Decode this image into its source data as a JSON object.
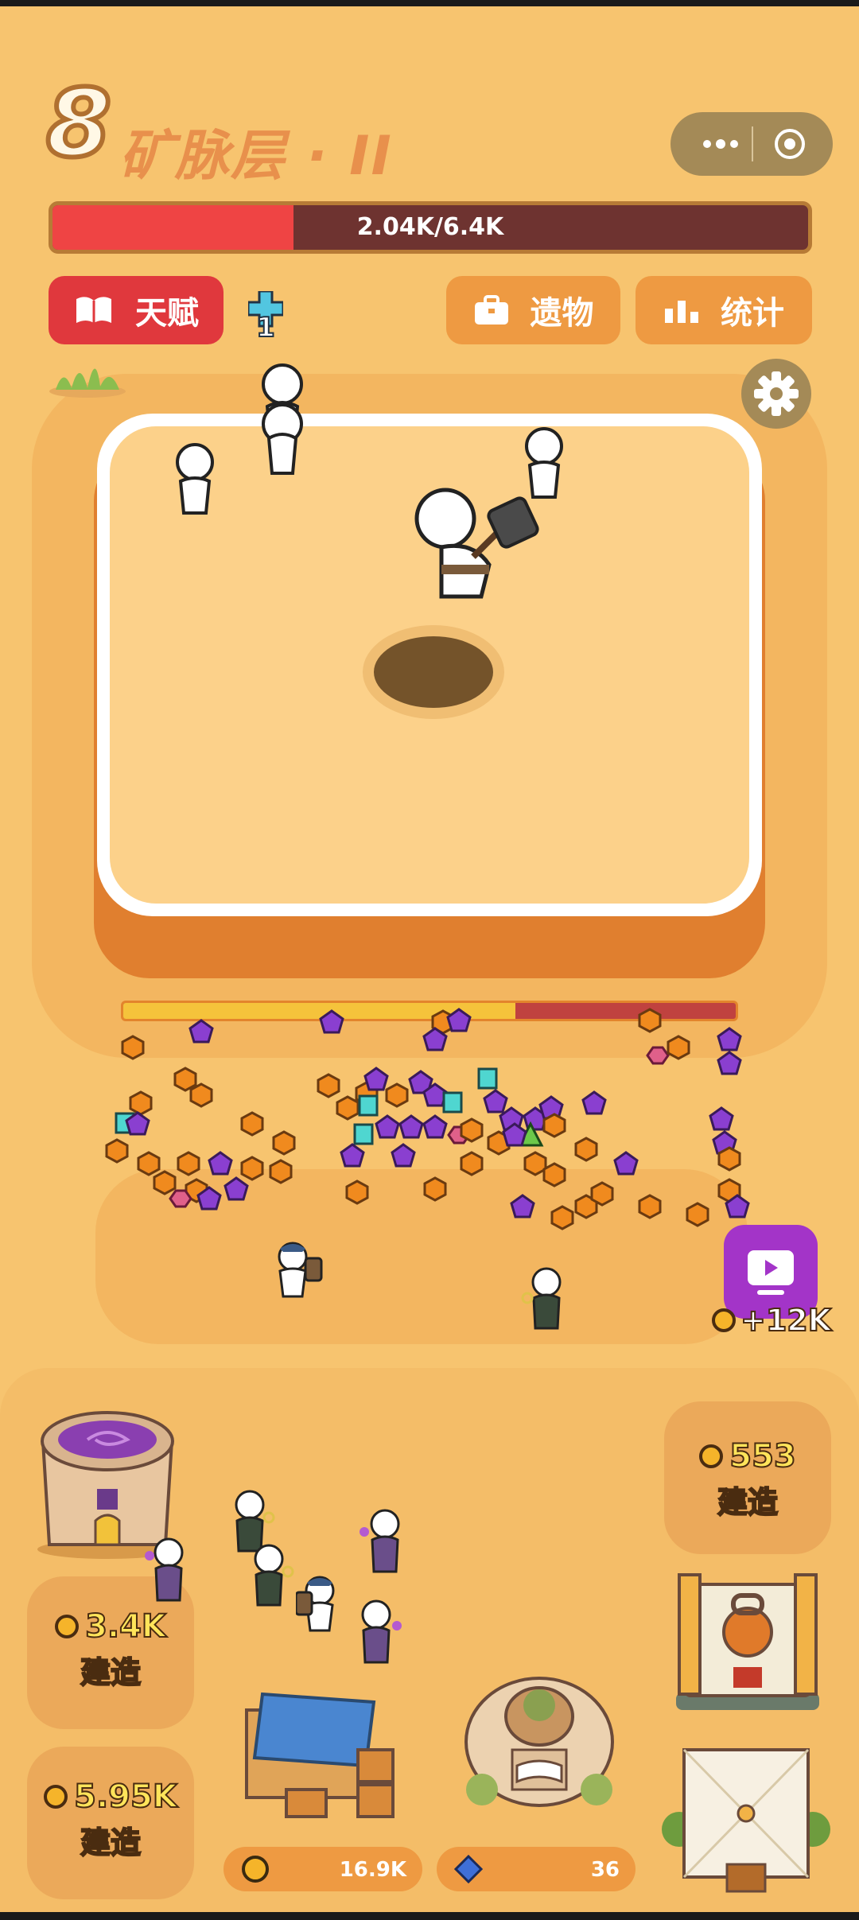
{
  "header": {
    "level_number": "8",
    "level_title": "矿脉层 · II"
  },
  "hp_bar": {
    "text": "2.04K/6.4K",
    "fraction": 0.319
  },
  "buttons": {
    "talent_label": "天赋",
    "relic_label": "遗物",
    "stats_label": "统计"
  },
  "cross_badge": {
    "count": "1"
  },
  "mining_progress": {
    "fraction": 0.64
  },
  "ad_reward": {
    "text": "+12K"
  },
  "buildings": {
    "top_right": {
      "cost": "553",
      "label": "建造"
    },
    "left_mid": {
      "cost": "3.4K",
      "label": "建造"
    },
    "left_bottom": {
      "cost": "5.95K",
      "label": "建造"
    }
  },
  "resources": {
    "coins": "16.9K",
    "gems": "36"
  },
  "colors": {
    "sand": "#f7c46f",
    "hp_fill": "#ef4444",
    "hp_bg": "#6e3330",
    "talent_button": "#e0383d",
    "orange_button": "#ee9a42",
    "ad_button": "#a334c8"
  },
  "icons": {
    "talent": "book-icon",
    "relic": "briefcase-icon",
    "stats": "bar-chart-icon",
    "settings": "gear-icon",
    "menu": "more-dots-icon",
    "record": "target-icon",
    "ad": "video-play-icon",
    "coin": "coin-icon",
    "gem": "gem-icon"
  }
}
